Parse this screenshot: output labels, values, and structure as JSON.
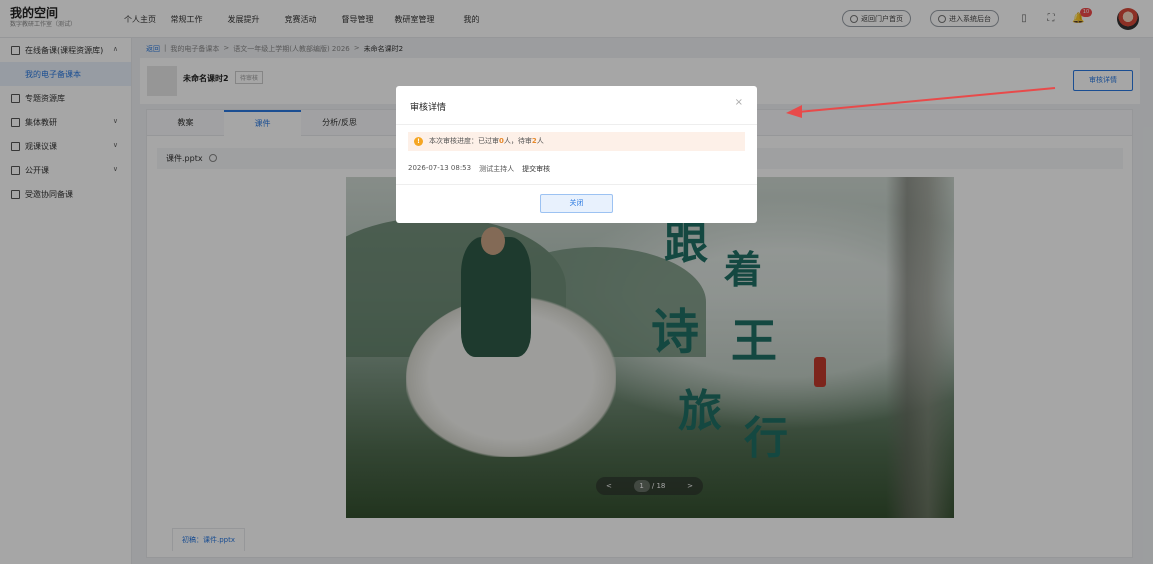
{
  "header": {
    "brand_title": "我的空间",
    "brand_subtitle": "数字教研工作室（测试）",
    "nav": [
      "个人主页",
      "常规工作",
      "发展提升",
      "竞赛活动",
      "督导管理",
      "教研室管理",
      "我的"
    ],
    "portal_button": "返回门户首页",
    "admin_button": "进入系统后台",
    "notification_count": "10"
  },
  "sidebar": {
    "items": [
      {
        "label": "在线备课(课程资源库)",
        "chevron": "∧"
      },
      {
        "label": "我的电子备课本",
        "chevron": ""
      },
      {
        "label": "专题资源库",
        "chevron": ""
      },
      {
        "label": "集体教研",
        "chevron": "∨"
      },
      {
        "label": "观课议课",
        "chevron": "∨"
      },
      {
        "label": "公开课",
        "chevron": "∨"
      },
      {
        "label": "受邀协同备课",
        "chevron": ""
      }
    ]
  },
  "breadcrumb": {
    "back": "返回",
    "items": [
      "我的电子备课本",
      ">",
      "语文一年级上学期(人教部编版) 2026",
      ">"
    ],
    "current": "未命名课时2"
  },
  "doc": {
    "title": "未命名课时2",
    "status": "待审核",
    "review_button": "审核详情"
  },
  "tabs": [
    "教案",
    "课件",
    "分析/反思"
  ],
  "active_tab": 1,
  "file": {
    "name": "课件.pptx"
  },
  "slide": {
    "chars": [
      "跟",
      "着",
      "诗",
      "王",
      "旅",
      "行"
    ],
    "prev": "<",
    "page": "1",
    "total": "/ 18",
    "next": ">"
  },
  "bottom_tab": "初稿：课件.pptx",
  "modal": {
    "title": "审核详情",
    "close_icon": "×",
    "alert_prefix": "本次审核进度：已过审",
    "passed": "0",
    "alert_mid": "人，待审",
    "pending": "2",
    "alert_suffix": "人",
    "log": {
      "time": "2026-07-13 08:53",
      "user": "测试主持人",
      "action": "提交审核"
    },
    "button": "关闭"
  },
  "colors": {
    "accent": "#2a79e0",
    "warning": "#f5a623",
    "arrow": "#e84a4a"
  }
}
